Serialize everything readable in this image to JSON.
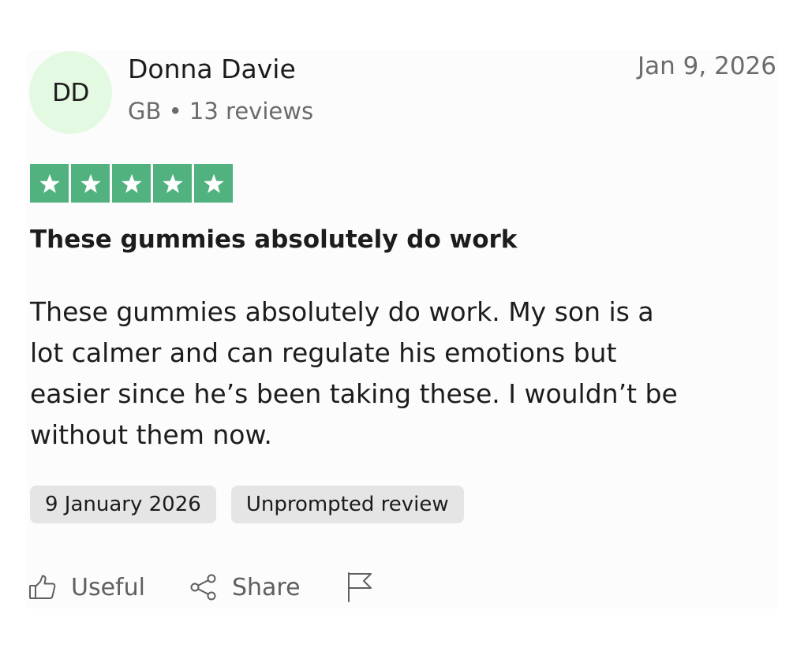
{
  "reviewer": {
    "initials": "DD",
    "name": "Donna Davie",
    "country": "GB",
    "separator": "•",
    "review_count": "13 reviews"
  },
  "review": {
    "date_short": "Jan 9, 2026",
    "rating": 5,
    "rating_max": 5,
    "title": "These gummies absolutely do work",
    "body": "These gummies absolutely do work. My son is a lot calmer and can regulate his emotions but easier since he’s been taking these. I wouldn’t be without them now.",
    "tags": [
      "9 January 2026",
      "Unprompted review"
    ]
  },
  "actions": {
    "useful_label": "Useful",
    "share_label": "Share"
  },
  "icons": {
    "like": "thumbs-up-icon",
    "share": "share-icon",
    "report": "flag-icon",
    "star": "star-icon"
  },
  "colors": {
    "star_green": "#52b27f",
    "avatar_bg": "#e3f9e1",
    "tag_bg": "#e5e5e5",
    "muted_text": "#6b6b6b"
  }
}
